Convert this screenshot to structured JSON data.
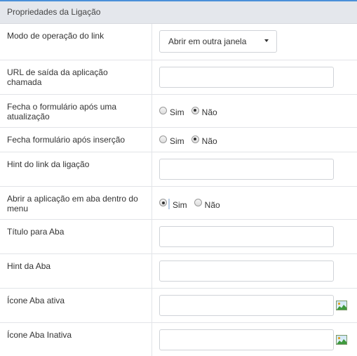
{
  "panel": {
    "title": "Propriedades da Ligação"
  },
  "fields": {
    "link_mode": {
      "label": "Modo de operação do link",
      "selected": "Abrir em outra janela"
    },
    "exit_url": {
      "label": "URL de saída da aplicação chamada",
      "value": ""
    },
    "close_after_update": {
      "label": "Fecha o formulário após uma atualização",
      "option_yes": "Sim",
      "option_no": "Não",
      "selected": "Não"
    },
    "close_after_insert": {
      "label": "Fecha formulário após inserção",
      "option_yes": "Sim",
      "option_no": "Não",
      "selected": "Não"
    },
    "link_hint": {
      "label": "Hint do link da ligação",
      "value": ""
    },
    "open_in_tab": {
      "label": "Abrir a aplicação em aba dentro do menu",
      "option_yes": "Sim",
      "option_no": "Não",
      "selected": "Sim"
    },
    "tab_title": {
      "label": "Título para Aba",
      "value": ""
    },
    "tab_hint": {
      "label": "Hint da Aba",
      "value": ""
    },
    "active_tab_icon": {
      "label": "Ícone Aba ativa",
      "value": "",
      "icon": "image-icon"
    },
    "inactive_tab_icon": {
      "label": "Ícone Aba Inativa",
      "value": "",
      "icon": "image-icon"
    }
  },
  "colors": {
    "accent": "#4a90d9",
    "header_bg": "#e4e7ec",
    "border": "#e2e4e8"
  }
}
